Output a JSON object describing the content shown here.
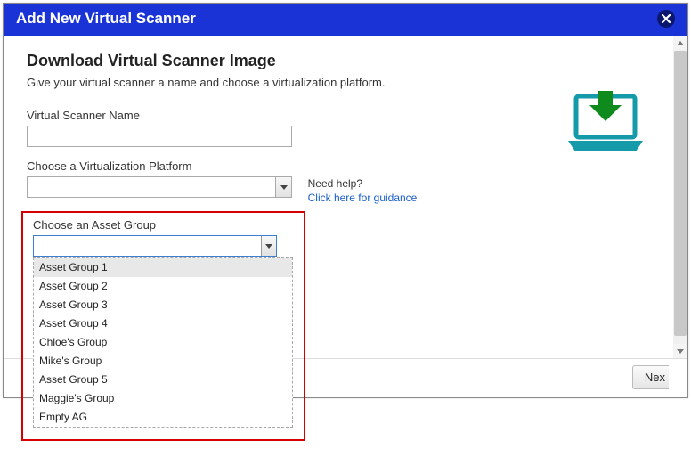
{
  "titlebar": {
    "title": "Add New Virtual Scanner"
  },
  "main": {
    "heading": "Download Virtual Scanner Image",
    "subhead": "Give your virtual scanner a name and choose a virtualization platform."
  },
  "form": {
    "scanner_name_label": "Virtual Scanner Name",
    "platform_label": "Choose a Virtualization Platform",
    "help_q": "Need help?",
    "help_link": "Click here for guidance"
  },
  "asset": {
    "label": "Choose an Asset Group",
    "options": [
      "Asset Group 1",
      "Asset Group 2",
      "Asset Group 3",
      "Asset Group 4",
      "Chloe's Group",
      "Mike's Group",
      "Asset Group 5",
      "Maggie's Group",
      "Empty AG"
    ],
    "selected_index": 0
  },
  "footer": {
    "next_label": "Nex"
  }
}
